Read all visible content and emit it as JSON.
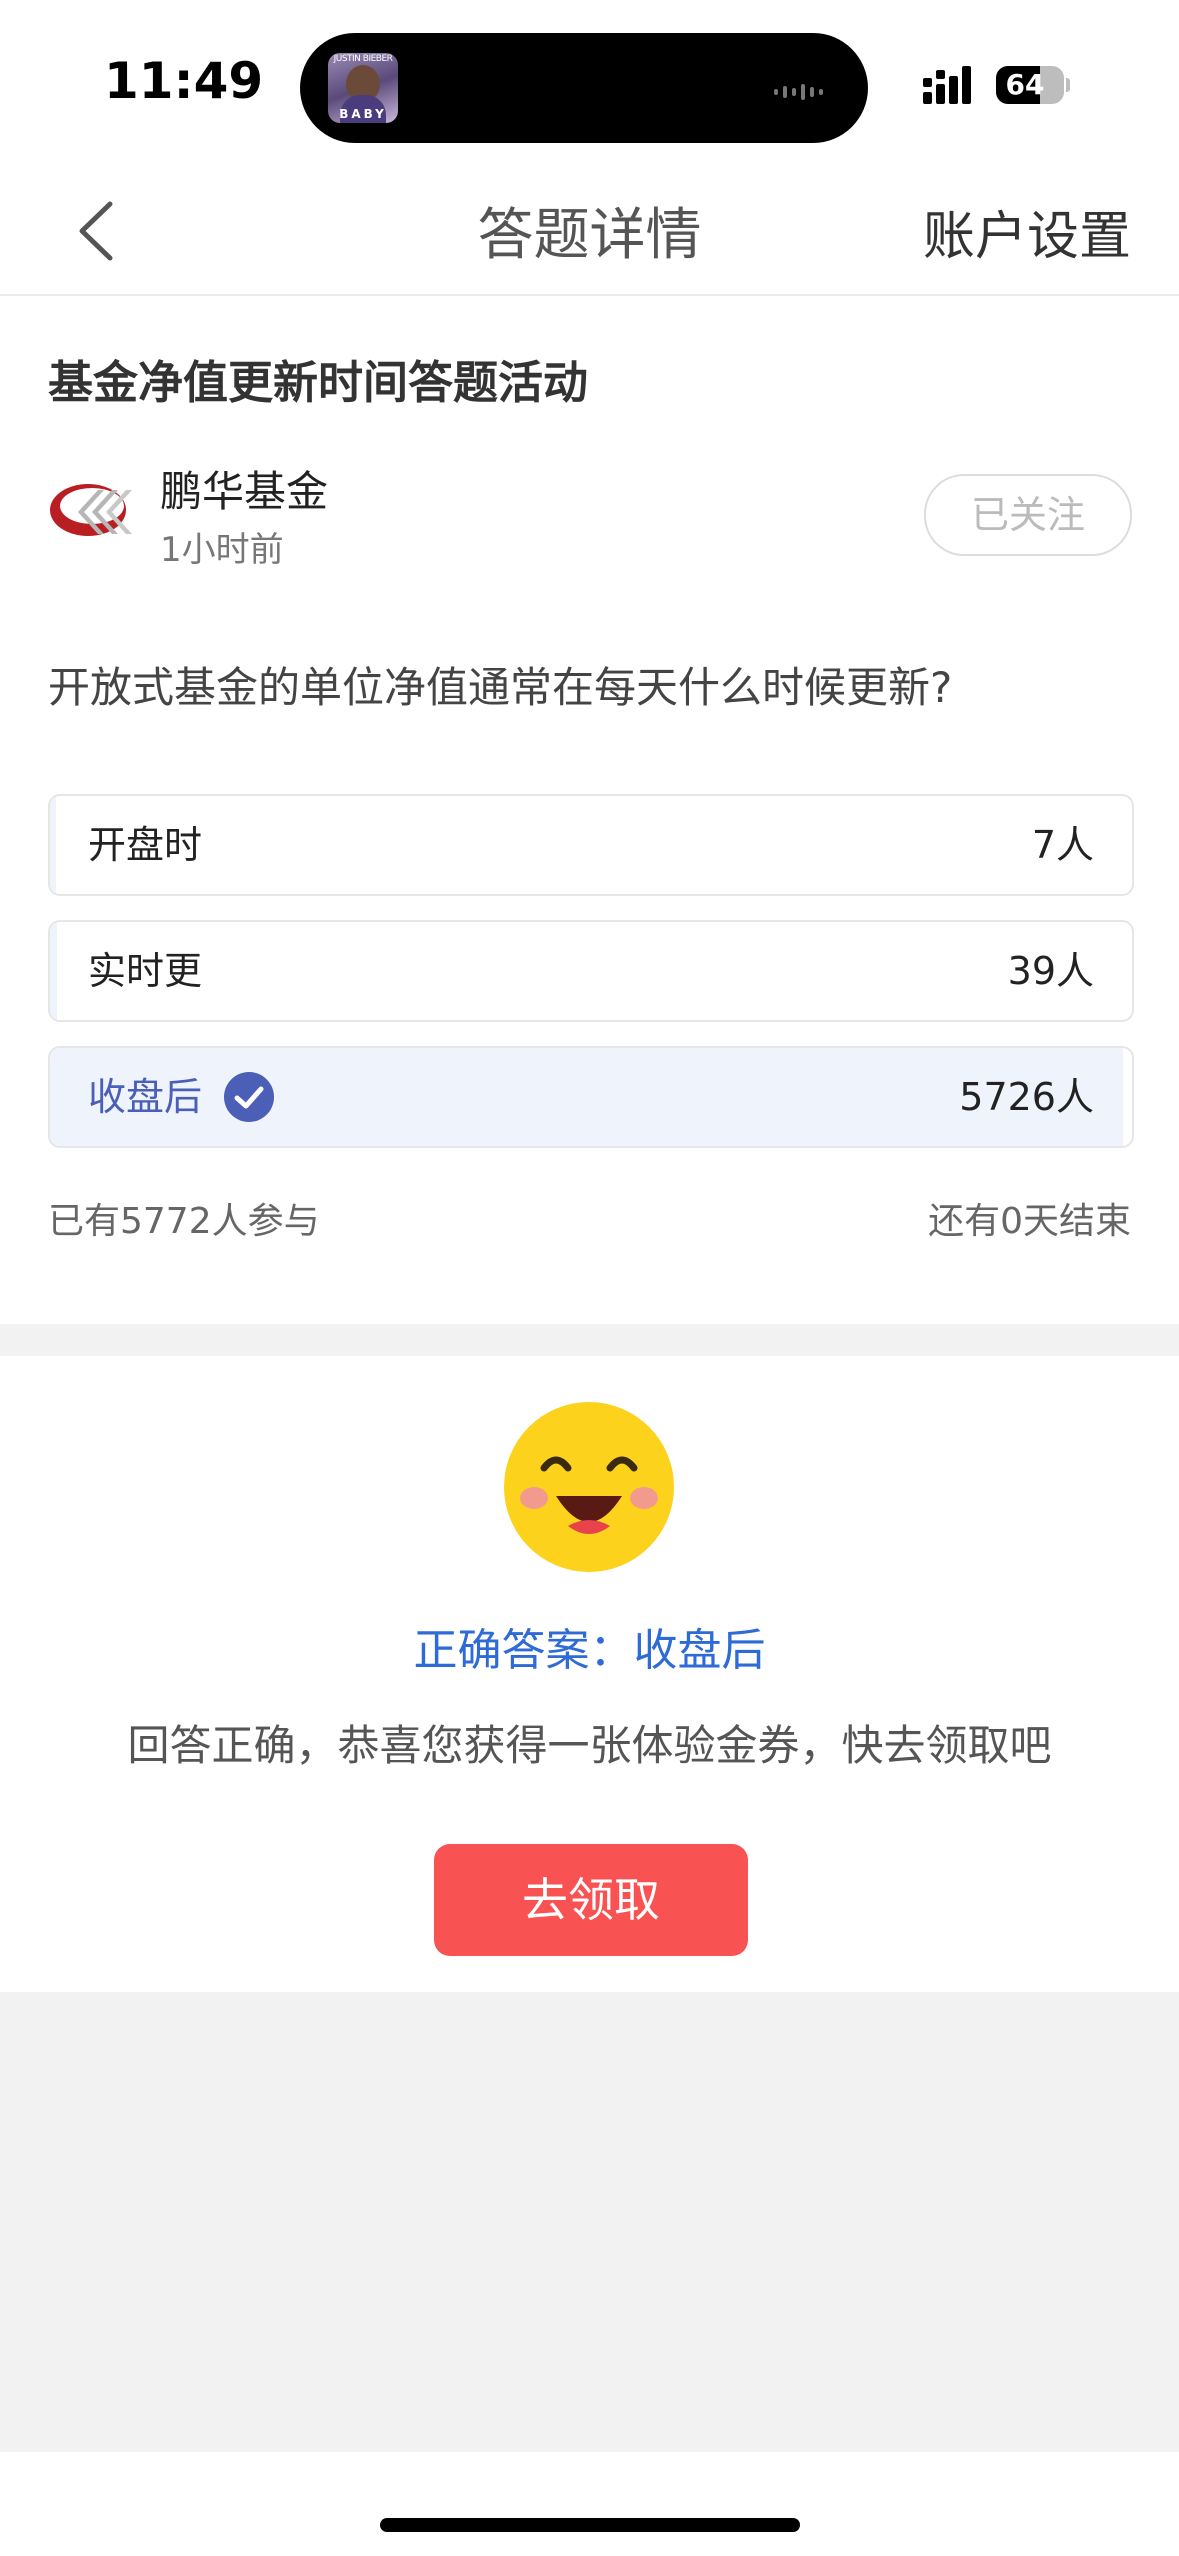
{
  "status_bar": {
    "time": "11:49",
    "battery": "64",
    "battery_level": 0.64,
    "album_top": "JUSTIN BIEBER",
    "album_bottom": "BABY"
  },
  "nav": {
    "title": "答题详情",
    "right_action": "账户设置"
  },
  "activity": {
    "title": "基金净值更新时间答题活动",
    "publisher": "鹏华基金",
    "posted": "1小时前",
    "follow_label": "已关注",
    "question": "开放式基金的单位净值通常在每天什么时候更新?",
    "options": [
      {
        "label": "开盘时",
        "count": "7人",
        "share": 0.0012
      },
      {
        "label": "实时更",
        "count": "39人",
        "share": 0.0068
      },
      {
        "label": "收盘后",
        "count": "5726人",
        "share": 0.992,
        "correct": true
      }
    ],
    "participants": "已有5772人参与",
    "remaining": "还有0天结束"
  },
  "result": {
    "answer": "正确答案：收盘后",
    "message": "回答正确，恭喜您获得一张体验金券，快去领取吧",
    "claim_label": "去领取"
  },
  "colors": {
    "accent": "#4a5fb5",
    "answer": "#2f6bd6",
    "button": "#f85252",
    "option_fill": "#eef3fc"
  }
}
